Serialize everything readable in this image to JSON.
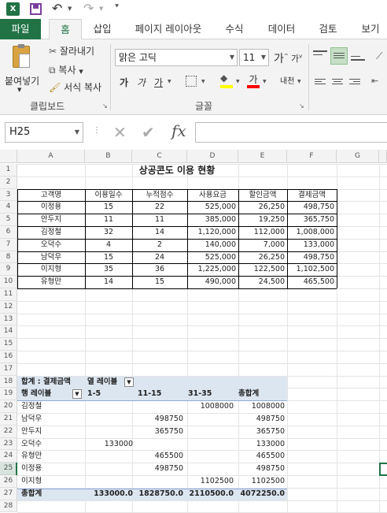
{
  "qat": {
    "excel_icon": "excel-icon",
    "save_icon": "save-icon",
    "undo_icon": "undo-icon",
    "redo_icon": "redo-icon",
    "customize_icon": "customize-icon"
  },
  "tabs": [
    {
      "label": "파일"
    },
    {
      "label": "홈"
    },
    {
      "label": "삽입"
    },
    {
      "label": "페이지 레이아웃"
    },
    {
      "label": "수식"
    },
    {
      "label": "데이터"
    },
    {
      "label": "검토"
    },
    {
      "label": "보기"
    }
  ],
  "clipboard": {
    "paste_label": "붙여넣기",
    "cut_label": "잘라내기",
    "copy_label": "복사",
    "format_painter_label": "서식 복사",
    "group_label": "클립보드"
  },
  "font": {
    "name": "맑은 고딕",
    "size": "11",
    "group_label": "글꼴",
    "grow_label": "가",
    "shrink_label": "가",
    "bold": "가",
    "italic": "가",
    "underline": "가",
    "highlight_color": "#ffff00",
    "font_color": "#ff0000",
    "phonetic_label": "내천"
  },
  "formula_bar": {
    "name_box": "H25",
    "fx_label": "fx",
    "formula": ""
  },
  "columns": [
    "A",
    "B",
    "C",
    "D",
    "E",
    "F",
    "G"
  ],
  "rows": [
    "1",
    "2",
    "3",
    "4",
    "5",
    "6",
    "7",
    "8",
    "9",
    "10",
    "11",
    "12",
    "13",
    "14",
    "15",
    "16",
    "17",
    "18",
    "19",
    "20",
    "21",
    "22",
    "23",
    "24",
    "25",
    "26",
    "27",
    "28"
  ],
  "table": {
    "title": "상공콘도 이용 현황",
    "headers": [
      "고객명",
      "이용일수",
      "누적점수",
      "사용요금",
      "할인금액",
      "결제금액"
    ],
    "rows": [
      [
        "이정용",
        "15",
        "22",
        "525,000",
        "26,250",
        "498,750"
      ],
      [
        "안두지",
        "11",
        "11",
        "385,000",
        "19,250",
        "365,750"
      ],
      [
        "김정철",
        "32",
        "14",
        "1,120,000",
        "112,000",
        "1,008,000"
      ],
      [
        "오덕수",
        "4",
        "2",
        "140,000",
        "7,000",
        "133,000"
      ],
      [
        "남덕우",
        "15",
        "24",
        "525,000",
        "26,250",
        "498,750"
      ],
      [
        "이지형",
        "35",
        "36",
        "1,225,000",
        "122,500",
        "1,102,500"
      ],
      [
        "유형만",
        "14",
        "15",
        "490,000",
        "24,500",
        "465,500"
      ]
    ]
  },
  "pivot": {
    "r18": [
      "합계 : 결제금액",
      "열 레이블"
    ],
    "r19": [
      "행 레이블",
      "1-5",
      "11-15",
      "31-35",
      "총합계"
    ],
    "rows": [
      [
        "김정철",
        "",
        "",
        "1008000",
        "1008000"
      ],
      [
        "남덕우",
        "",
        "498750",
        "",
        "498750"
      ],
      [
        "안두지",
        "",
        "365750",
        "",
        "365750"
      ],
      [
        "오덕수",
        "133000",
        "",
        "",
        "133000"
      ],
      [
        "유형만",
        "",
        "465500",
        "",
        "465500"
      ],
      [
        "이정용",
        "",
        "498750",
        "",
        "498750"
      ],
      [
        "이지형",
        "",
        "",
        "1102500",
        "1102500"
      ]
    ],
    "total": [
      "총합계",
      "133000.0",
      "1828750.0",
      "2110500.0",
      "4072250.0"
    ]
  }
}
